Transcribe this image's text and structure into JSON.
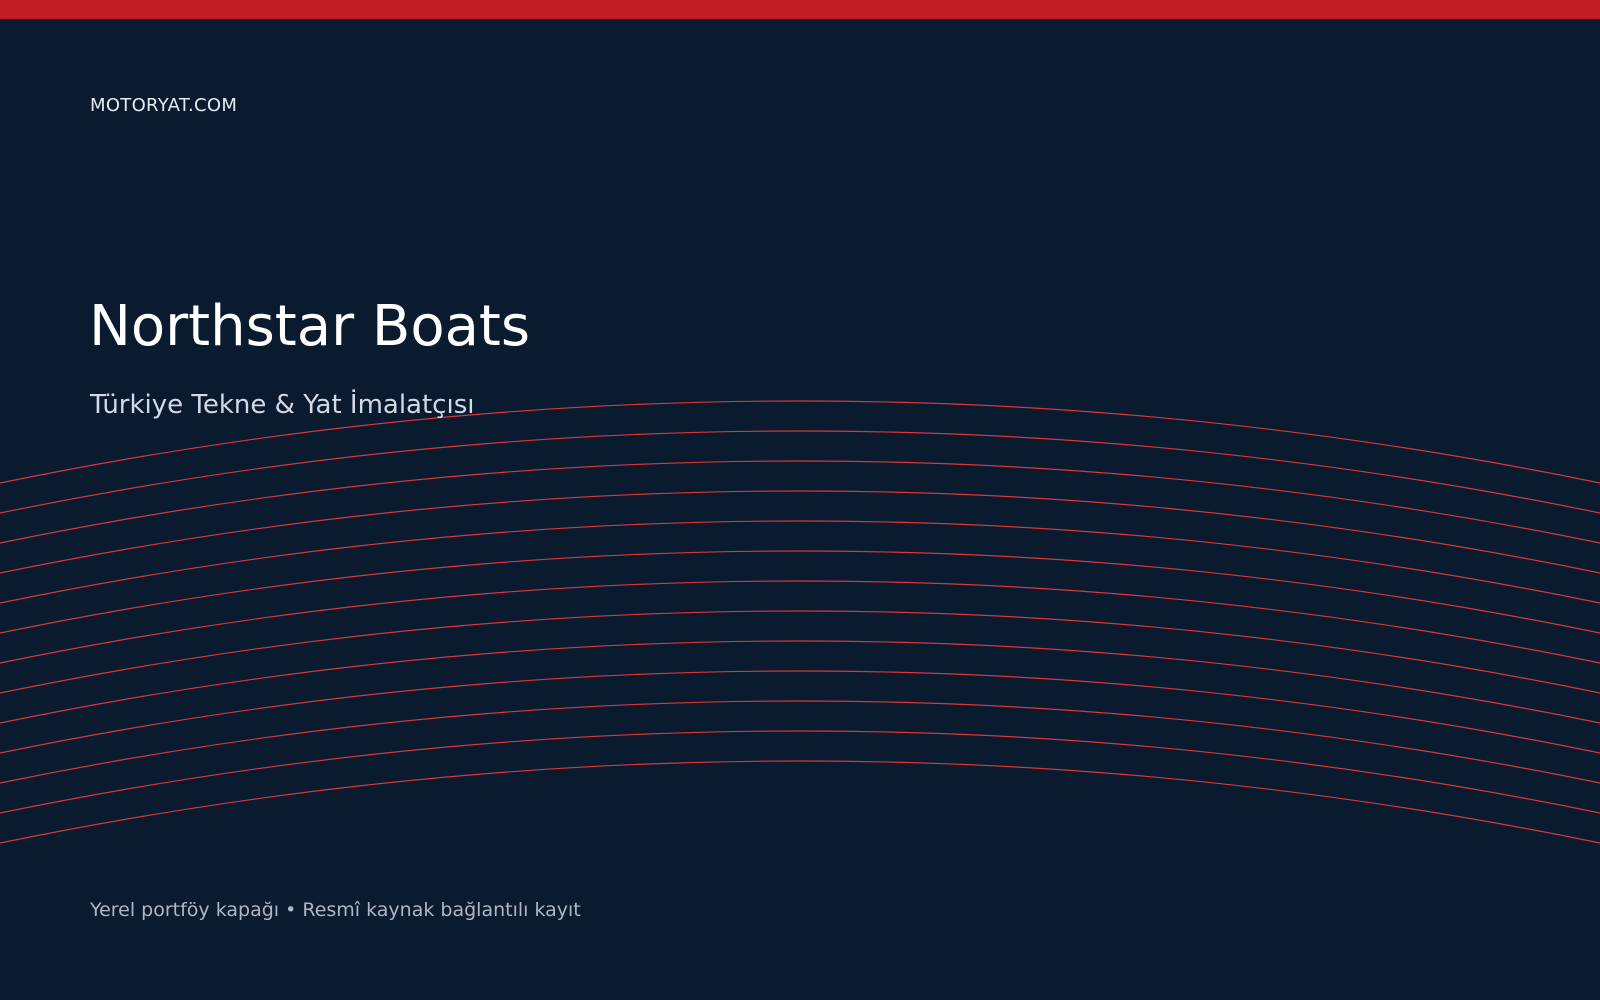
{
  "colors": {
    "background": "#0a1a2f",
    "accent_red": "#c01c24",
    "wave_line": "#d9373c"
  },
  "header": {
    "brand": "MOTORYAT.COM"
  },
  "hero": {
    "title": "Northstar Boats",
    "subtitle": "Türkiye Tekne & Yat İmalatçısı"
  },
  "footer": {
    "note": "Yerel portföy kapağı • Resmî kaynak bağlantılı kayıt"
  }
}
